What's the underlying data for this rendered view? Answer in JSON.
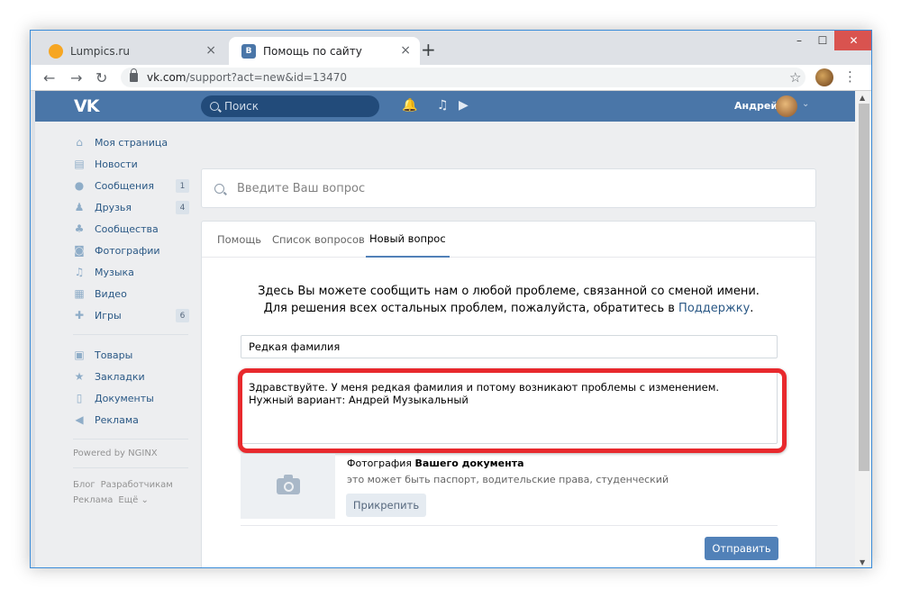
{
  "browser": {
    "tabs": [
      {
        "label": "Lumpics.ru",
        "close": "×"
      },
      {
        "label": "Помощь по сайту",
        "close": "×"
      }
    ],
    "new_tab": "+",
    "window_buttons": {
      "minimize": "–",
      "maximize": "☐",
      "close": "✕"
    },
    "nav": {
      "back": "←",
      "forward": "→",
      "reload": "↻"
    },
    "url_host": "vk.com",
    "url_rest": "/support?act=new&id=13470",
    "bookmark_icon": "☆",
    "menu_icon": "⋮"
  },
  "vk_header": {
    "logo": "VK",
    "search_placeholder": "Поиск",
    "user_name": "Андрей",
    "chevron": "⌄"
  },
  "sidebar": {
    "items": [
      {
        "label": "Моя страница",
        "icon": "⌂"
      },
      {
        "label": "Новости",
        "icon": "▤"
      },
      {
        "label": "Сообщения",
        "icon": "●",
        "badge": "1"
      },
      {
        "label": "Друзья",
        "icon": "♟",
        "badge": "4"
      },
      {
        "label": "Сообщества",
        "icon": "♣"
      },
      {
        "label": "Фотографии",
        "icon": "◙"
      },
      {
        "label": "Музыка",
        "icon": "♫"
      },
      {
        "label": "Видео",
        "icon": "▦"
      },
      {
        "label": "Игры",
        "icon": "✚",
        "badge": "6"
      }
    ],
    "items2": [
      {
        "label": "Товары",
        "icon": "▣"
      },
      {
        "label": "Закладки",
        "icon": "★"
      },
      {
        "label": "Документы",
        "icon": "▯"
      },
      {
        "label": "Реклама",
        "icon": "◀"
      }
    ],
    "powered": "Powered by NGINX",
    "footer_links": [
      "Блог",
      "Разработчикам",
      "Реклама",
      "Ещё ⌄"
    ]
  },
  "support": {
    "question_placeholder": "Введите Ваш вопрос",
    "tabs": [
      "Помощь",
      "Список вопросов",
      "Новый вопрос"
    ],
    "notice_line1": "Здесь Вы можете сообщить нам о любой проблеме, связанной со сменой имени.",
    "notice_line2_prefix": "Для решения всех остальных проблем, пожалуйста, обратитесь в ",
    "notice_link": "Поддержку",
    "notice_suffix": ".",
    "subject_value": "Редкая фамилия",
    "message_line1": "Здравствуйте. У меня редкая фамилия и потому возникают проблемы с изменением.",
    "message_line2": "Нужный вариант: Андрей Музыкальный",
    "doc_title_light": "Фотография ",
    "doc_title_bold": "Вашего документа",
    "doc_subtitle": "это может быть паспорт, водительские права, студенческий",
    "attach_label": "Прикрепить",
    "send_label": "Отправить"
  },
  "colors": {
    "vk_blue": "#4a76a8",
    "link": "#2a5885",
    "highlight_red": "#e8292d",
    "button_blue": "#5181b8"
  }
}
